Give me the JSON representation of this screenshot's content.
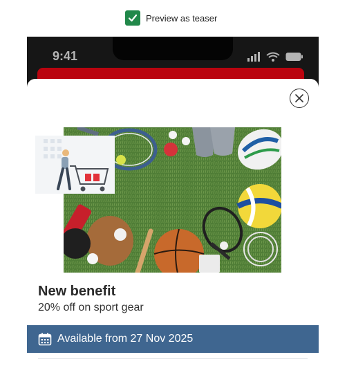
{
  "preview": {
    "label": "Preview as teaser",
    "checked": true
  },
  "phone": {
    "status_time": "9:41",
    "status_icons": [
      "signal-icon",
      "wifi-icon",
      "battery-icon"
    ]
  },
  "teaser": {
    "title": "New benefit",
    "subtitle": "20% off on sport gear",
    "availability": "Available from 27 Nov 2025",
    "close_icon": "close-icon",
    "availability_icon": "calendar-icon"
  },
  "colors": {
    "checkbox": "#21884a",
    "accent_red": "#e30613",
    "availability_bar": "#3f6690"
  }
}
